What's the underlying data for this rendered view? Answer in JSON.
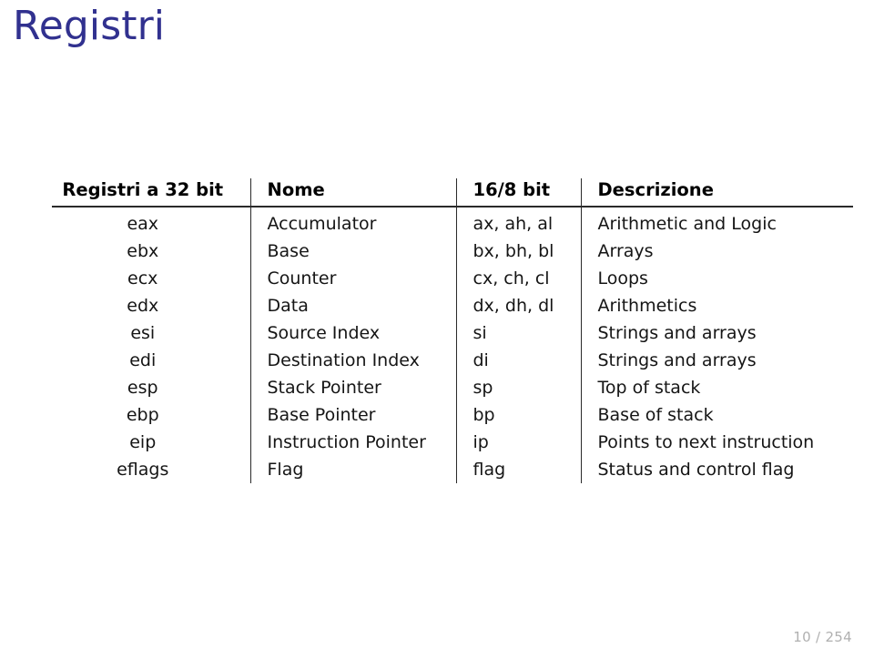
{
  "slide": {
    "title": "Registri",
    "title_color": "#31318f",
    "page_number": "10 / 254"
  },
  "table": {
    "headers": [
      "Registri a 32 bit",
      "Nome",
      "16/8 bit",
      "Descrizione"
    ],
    "rows": [
      {
        "reg32": "eax",
        "name": "Accumulator",
        "bits": "ax, ah, al",
        "desc": "Arithmetic and Logic"
      },
      {
        "reg32": "ebx",
        "name": "Base",
        "bits": "bx, bh, bl",
        "desc": "Arrays"
      },
      {
        "reg32": "ecx",
        "name": "Counter",
        "bits": "cx, ch, cl",
        "desc": "Loops"
      },
      {
        "reg32": "edx",
        "name": "Data",
        "bits": "dx, dh, dl",
        "desc": "Arithmetics"
      },
      {
        "reg32": "esi",
        "name": "Source Index",
        "bits": "si",
        "desc": "Strings and arrays"
      },
      {
        "reg32": "edi",
        "name": "Destination Index",
        "bits": "di",
        "desc": "Strings and arrays"
      },
      {
        "reg32": "esp",
        "name": "Stack Pointer",
        "bits": "sp",
        "desc": "Top of stack"
      },
      {
        "reg32": "ebp",
        "name": "Base Pointer",
        "bits": "bp",
        "desc": "Base of stack"
      },
      {
        "reg32": "eip",
        "name": "Instruction Pointer",
        "bits": "ip",
        "desc": "Points to next instruction"
      },
      {
        "reg32": "eflags",
        "name": "Flag",
        "bits": "flag",
        "desc": "Status and control flag"
      }
    ]
  }
}
